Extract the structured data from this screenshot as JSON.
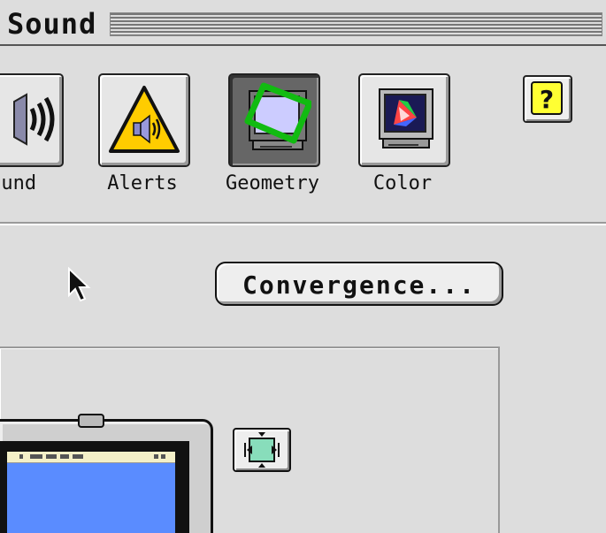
{
  "window": {
    "title": "Sound"
  },
  "toolbar": {
    "tabs": [
      {
        "label": "Sound",
        "icon": "speaker-icon"
      },
      {
        "label": "Alerts",
        "icon": "alert-speaker-icon"
      },
      {
        "label": "Geometry",
        "icon": "geometry-monitor-icon",
        "selected": true
      },
      {
        "label": "Color",
        "icon": "color-monitor-icon"
      }
    ],
    "help_label": "?"
  },
  "main": {
    "convergence_label": "Convergence..."
  },
  "colors": {
    "window_bg": "#dddddd",
    "geometry_green": "#11bb11",
    "alert_yellow": "#ffcc00",
    "screen_blue": "#5a8cff"
  }
}
